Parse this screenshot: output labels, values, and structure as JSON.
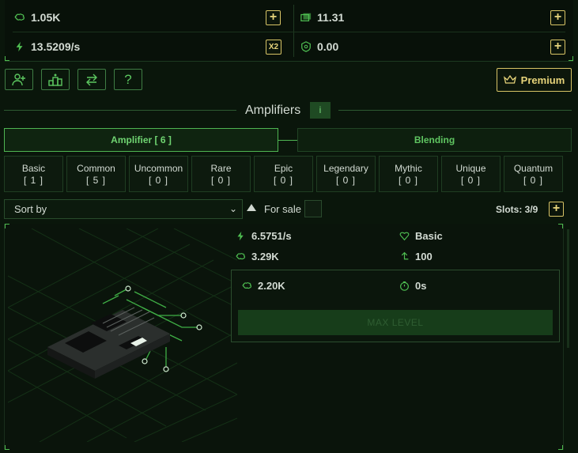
{
  "stats": {
    "brains": "1.05K",
    "cash": "11.31",
    "rate": "13.5209/s",
    "shield": "0.00",
    "x2_label": "X2",
    "plus_label": "+"
  },
  "toolbar": {
    "premium_label": "Premium"
  },
  "section": {
    "title": "Amplifiers",
    "info": "i"
  },
  "tabs": [
    {
      "label": "Amplifier [ 6 ]",
      "active": true
    },
    {
      "label": "Blending",
      "active": false
    }
  ],
  "rarities": [
    {
      "name": "Basic",
      "count": "[ 1 ]"
    },
    {
      "name": "Common",
      "count": "[ 5 ]"
    },
    {
      "name": "Uncommon",
      "count": "[ 0 ]"
    },
    {
      "name": "Rare",
      "count": "[ 0 ]"
    },
    {
      "name": "Epic",
      "count": "[ 0 ]"
    },
    {
      "name": "Legendary",
      "count": "[ 0 ]"
    },
    {
      "name": "Mythic",
      "count": "[ 0 ]"
    },
    {
      "name": "Unique",
      "count": "[ 0 ]"
    },
    {
      "name": "Quantum",
      "count": "[ 0 ]"
    }
  ],
  "sort": {
    "selected": "Sort by",
    "for_sale": "For sale",
    "slots": "Slots: 3/9"
  },
  "item": {
    "rate": "6.5751/s",
    "rarity": "Basic",
    "brains": "3.29K",
    "level": "100",
    "upgrade_cost": "2.20K",
    "cooldown": "0s",
    "action": "MAX LEVEL"
  },
  "colors": {
    "accent_green": "#4fb552",
    "gold": "#d8c466",
    "background": "#0a160b"
  }
}
